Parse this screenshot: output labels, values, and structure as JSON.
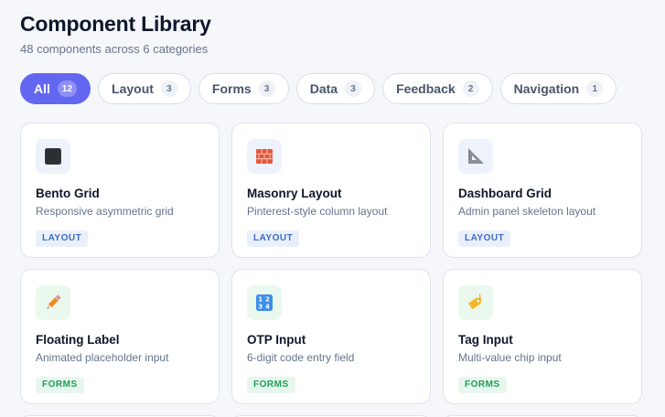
{
  "header": {
    "title": "Component Library",
    "subtitle": "48 components across 6 categories"
  },
  "filters": [
    {
      "label": "All",
      "count": "12",
      "active": true
    },
    {
      "label": "Layout",
      "count": "3"
    },
    {
      "label": "Forms",
      "count": "3"
    },
    {
      "label": "Data",
      "count": "3"
    },
    {
      "label": "Feedback",
      "count": "2"
    },
    {
      "label": "Navigation",
      "count": "1"
    }
  ],
  "cards": [
    {
      "title": "Bento Grid",
      "description": "Responsive asymmetric grid",
      "tag": "LAYOUT",
      "icon": "black-square-icon"
    },
    {
      "title": "Masonry Layout",
      "description": "Pinterest-style column layout",
      "tag": "LAYOUT",
      "icon": "brick-icon"
    },
    {
      "title": "Dashboard Grid",
      "description": "Admin panel skeleton layout",
      "tag": "LAYOUT",
      "icon": "triangular-ruler-icon"
    },
    {
      "title": "Floating Label",
      "description": "Animated placeholder input",
      "tag": "FORMS",
      "icon": "pencil-icon"
    },
    {
      "title": "OTP Input",
      "description": "6-digit code entry field",
      "tag": "FORMS",
      "icon": "numbers-keypad-icon"
    },
    {
      "title": "Tag Input",
      "description": "Multi-value chip input",
      "tag": "FORMS",
      "icon": "label-tag-icon"
    }
  ],
  "colors": {
    "accent": "#6366f1",
    "layout_tag": "#3b6cc9",
    "forms_tag": "#1e9e53",
    "background": "#f5f7fb"
  }
}
